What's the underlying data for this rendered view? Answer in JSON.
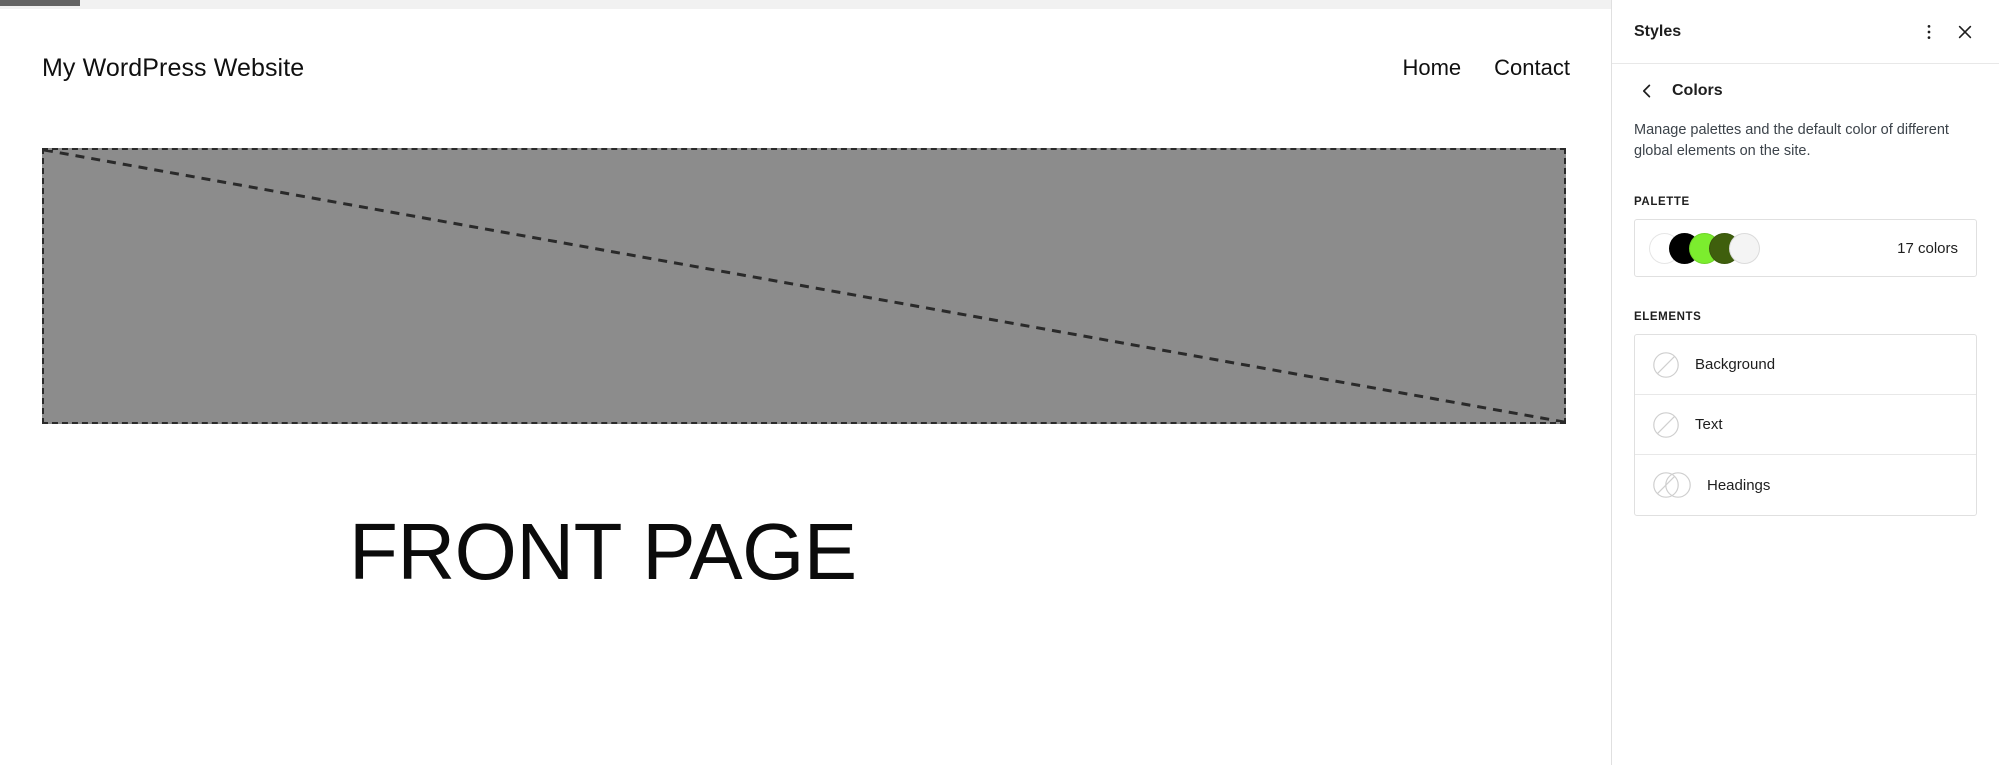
{
  "site_preview": {
    "title": "My WordPress Website",
    "nav": [
      {
        "label": "Home"
      },
      {
        "label": "Contact"
      }
    ],
    "image_placeholder": {
      "icon": "image-placeholder-icon"
    },
    "heading": "FRONT PAGE",
    "placeholder_fill": "#8c8c8c"
  },
  "styles_panel": {
    "header": {
      "title": "Styles",
      "more_icon": "more-vertical-icon",
      "close_icon": "close-icon"
    },
    "navigation": {
      "back_icon": "chevron-left-icon",
      "title": "Colors"
    },
    "description": "Manage palettes and the default color of different global elements on the site.",
    "palette": {
      "section_label": "Palette",
      "count_label": "17 colors",
      "swatches": [
        {
          "name": "white",
          "color": "#ffffff"
        },
        {
          "name": "black",
          "color": "#000000"
        },
        {
          "name": "bright-green",
          "color": "#7ced2e"
        },
        {
          "name": "dark-olive",
          "color": "#3f5f0d"
        },
        {
          "name": "off-white",
          "color": "#f4f4f4"
        }
      ]
    },
    "elements": {
      "section_label": "Elements",
      "items": [
        {
          "label": "Background",
          "icon": "color-circle-empty-icon"
        },
        {
          "label": "Text",
          "icon": "color-circle-empty-icon"
        },
        {
          "label": "Headings",
          "icon": "color-circle-pair-empty-icon"
        }
      ]
    }
  }
}
